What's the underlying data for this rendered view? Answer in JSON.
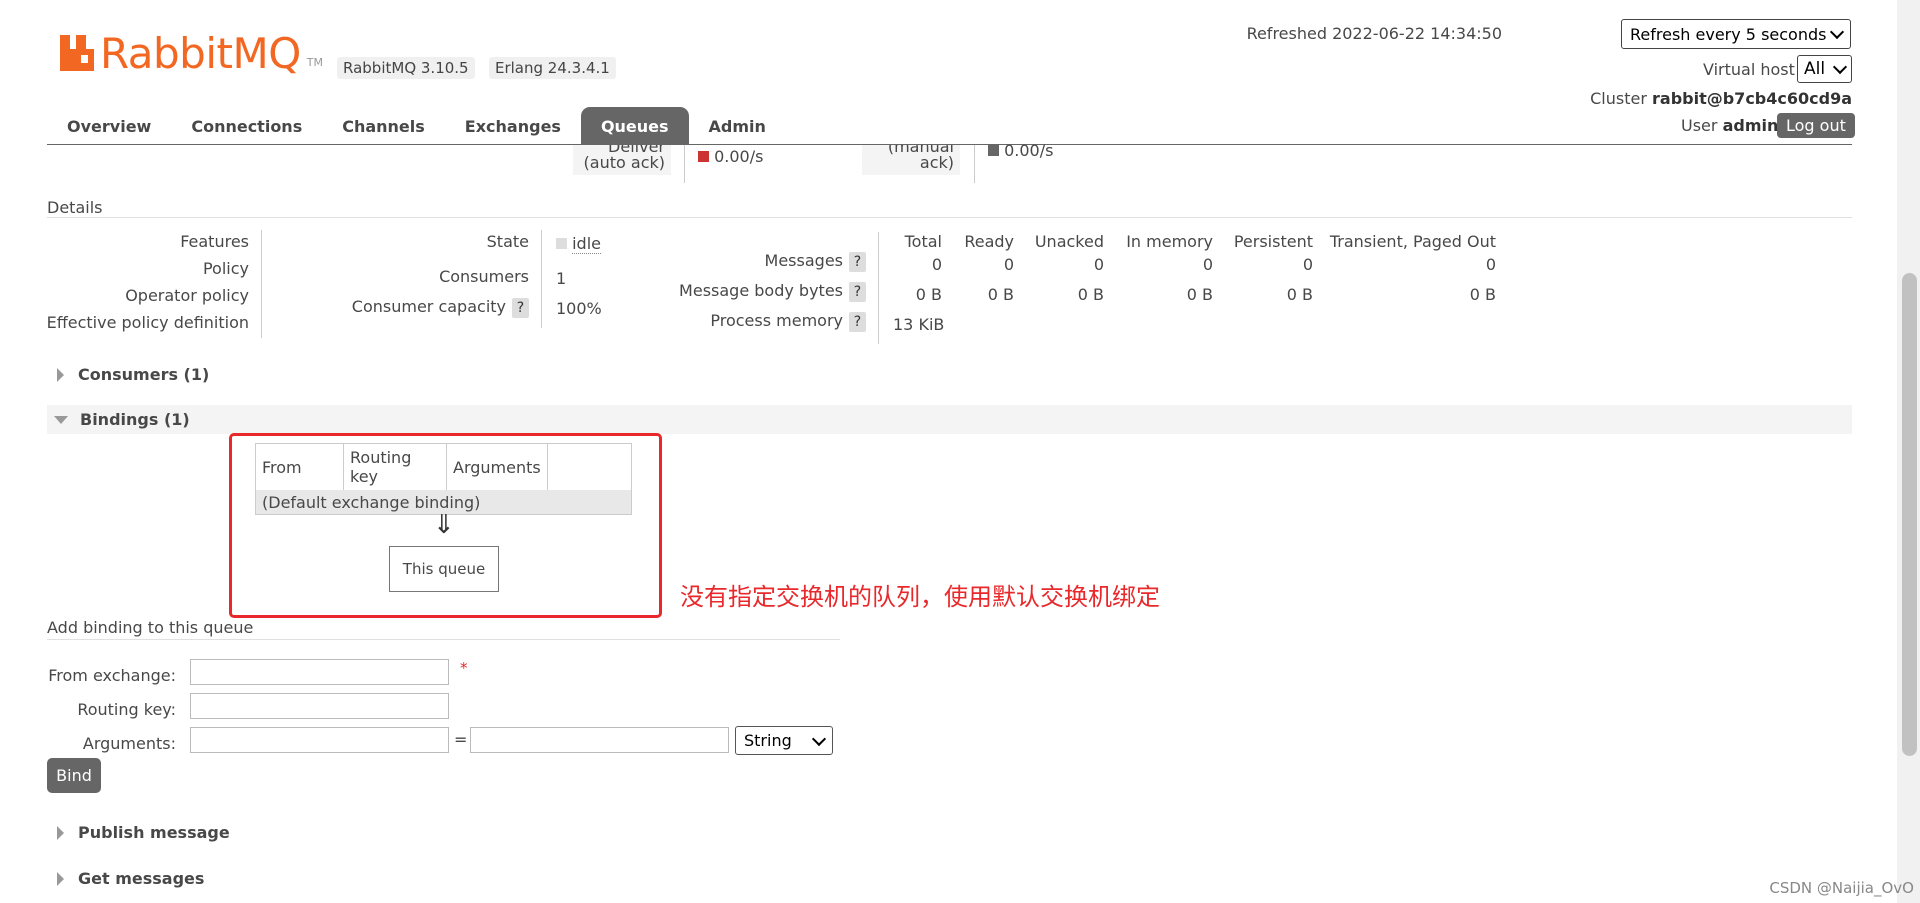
{
  "header": {
    "logo_text": "RabbitMQ",
    "logo_tm": "TM",
    "rabbitmq_version": "RabbitMQ 3.10.5",
    "erlang_version": "Erlang 24.3.4.1",
    "refreshed": "Refreshed 2022-06-22 14:34:50",
    "refresh_option": "Refresh every 5 seconds",
    "vhost_label": "Virtual host",
    "vhost_value": "All",
    "cluster_label": "Cluster",
    "cluster_value": "rabbit@b7cb4c60cd9a",
    "user_label": "User",
    "user_value": "admin",
    "logout": "Log out"
  },
  "nav": {
    "tabs": [
      "Overview",
      "Connections",
      "Channels",
      "Exchanges",
      "Queues",
      "Admin"
    ],
    "active": "Queues"
  },
  "rates_clipped": {
    "deliver_auto_line1": "Deliver",
    "deliver_auto_line2": "(auto ack)",
    "deliver_auto_rate": "0.00/s",
    "manual_line1": "(manual",
    "manual_line2": "ack)",
    "manual_rate": "0.00/s",
    "color_red": "#cc3333",
    "color_grey": "#666666"
  },
  "details": {
    "title": "Details",
    "policy_labels": [
      "Features",
      "Policy",
      "Operator policy",
      "Effective policy definition"
    ],
    "state_label": "State",
    "state_value": "idle",
    "consumers_label": "Consumers",
    "consumers_value": "1",
    "capacity_label": "Consumer capacity",
    "capacity_value": "100%",
    "help": "?",
    "columns": [
      "Total",
      "Ready",
      "Unacked",
      "In memory",
      "Persistent",
      "Transient, Paged Out"
    ],
    "rows": [
      {
        "label": "Messages",
        "values": [
          "0",
          "0",
          "0",
          "0",
          "0",
          "0"
        ]
      },
      {
        "label": "Message body bytes",
        "values": [
          "0 B",
          "0 B",
          "0 B",
          "0 B",
          "0 B",
          "0 B"
        ]
      },
      {
        "label": "Process memory",
        "values": [
          "13 KiB"
        ]
      }
    ]
  },
  "consumers_section": "Consumers (1)",
  "bindings_section": "Bindings (1)",
  "bindings": {
    "columns": [
      "From",
      "Routing key",
      "Arguments"
    ],
    "row": "(Default exchange binding)",
    "arrow": "⇓",
    "this_queue": "This queue"
  },
  "annotation": "没有指定交换机的队列，使用默认交换机绑定",
  "add_binding": {
    "title": "Add binding to this queue",
    "from_exchange": "From exchange:",
    "required": "*",
    "routing_key": "Routing key:",
    "arguments": "Arguments:",
    "equals": "=",
    "type_value": "String",
    "bind": "Bind"
  },
  "publish_section": "Publish message",
  "get_section": "Get messages",
  "watermark": "CSDN @Naijia_OvO",
  "colors": {
    "brand": "#f26822",
    "annotation_red": "#e8282b",
    "tab_active": "#666666"
  }
}
